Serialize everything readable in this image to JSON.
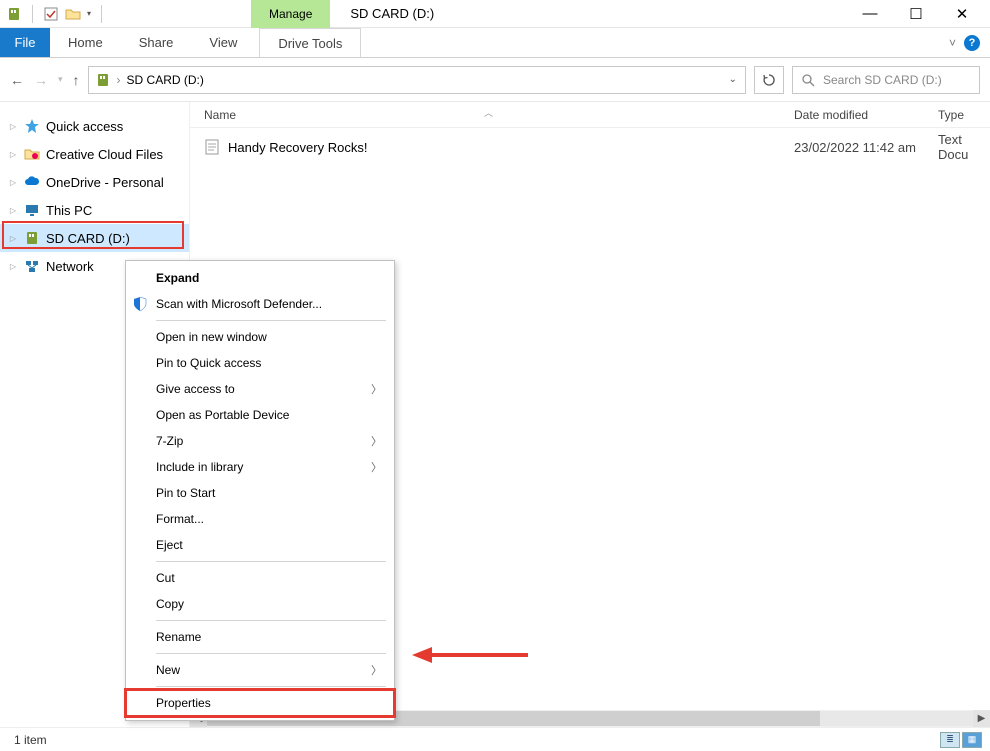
{
  "window": {
    "title": "SD CARD (D:)",
    "manage_label": "Manage",
    "win_buttons": {
      "minimize": "—",
      "maximize": "☐",
      "close": "✕"
    }
  },
  "ribbon": {
    "file": "File",
    "tabs": [
      "Home",
      "Share",
      "View"
    ],
    "drive_tools": "Drive Tools",
    "expand_caret": "˅"
  },
  "nav": {
    "address_path": "SD CARD (D:)",
    "search_placeholder": "Search SD CARD (D:)"
  },
  "tree": {
    "items": [
      {
        "label": "Quick access",
        "icon": "star",
        "color": "#3ea3e4"
      },
      {
        "label": "Creative Cloud Files",
        "icon": "folder-cc",
        "color": "#f5a623"
      },
      {
        "label": "OneDrive - Personal",
        "icon": "cloud",
        "color": "#0b78d1"
      },
      {
        "label": "This PC",
        "icon": "monitor",
        "color": "#2a7ab0"
      },
      {
        "label": "SD CARD (D:)",
        "icon": "sd",
        "color": "#7d9e35",
        "selected": true
      },
      {
        "label": "Network",
        "icon": "network",
        "color": "#2a7ab0"
      }
    ]
  },
  "columns": {
    "name": "Name",
    "date": "Date modified",
    "type": "Type"
  },
  "files": [
    {
      "name": "Handy Recovery Rocks!",
      "date": "23/02/2022 11:42 am",
      "type": "Text Docu"
    }
  ],
  "context_menu": {
    "items": [
      {
        "label": "Expand",
        "bold": true
      },
      {
        "label": "Scan with Microsoft Defender...",
        "icon": "shield"
      },
      {
        "sep": true
      },
      {
        "label": "Open in new window"
      },
      {
        "label": "Pin to Quick access"
      },
      {
        "label": "Give access to",
        "submenu": true
      },
      {
        "label": "Open as Portable Device"
      },
      {
        "label": "7-Zip",
        "submenu": true
      },
      {
        "label": "Include in library",
        "submenu": true
      },
      {
        "label": "Pin to Start"
      },
      {
        "label": "Format..."
      },
      {
        "label": "Eject"
      },
      {
        "sep": true
      },
      {
        "label": "Cut"
      },
      {
        "label": "Copy"
      },
      {
        "sep": true
      },
      {
        "label": "Rename"
      },
      {
        "sep": true
      },
      {
        "label": "New",
        "submenu": true
      },
      {
        "sep": true
      },
      {
        "label": "Properties",
        "highlighted": true
      }
    ]
  },
  "status": {
    "text": "1 item"
  },
  "annotations": {
    "tree_highlight_index": 4,
    "context_highlight_label": "Properties"
  }
}
